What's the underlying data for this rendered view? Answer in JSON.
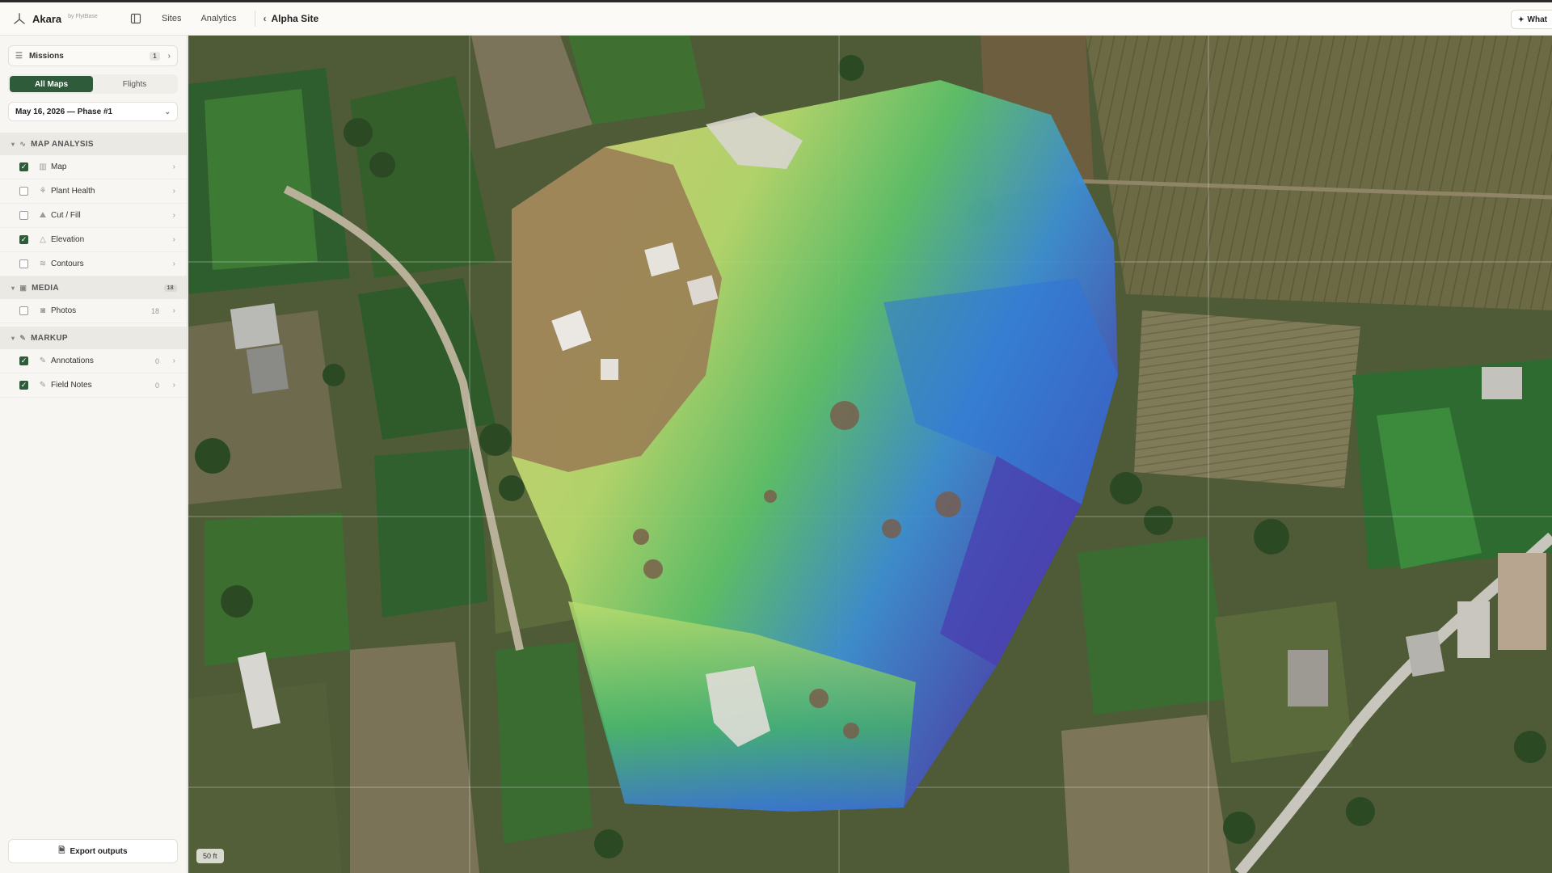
{
  "header": {
    "brand": "Akara",
    "brand_by": "by FlytBase",
    "nav": [
      "Sites",
      "Analytics"
    ],
    "breadcrumb": "Alpha Site",
    "whats_new": "What"
  },
  "sidebar": {
    "missions": {
      "label": "Missions",
      "count": "1"
    },
    "tabs": {
      "all_maps": "All Maps",
      "flights": "Flights"
    },
    "date_select": "May 16, 2026 — Phase #1",
    "sections": {
      "map_analysis": {
        "title": "MAP ANALYSIS",
        "items": [
          {
            "label": "Map",
            "checked": true,
            "icon": "map-icon"
          },
          {
            "label": "Plant Health",
            "checked": false,
            "icon": "leaf-icon"
          },
          {
            "label": "Cut / Fill",
            "checked": false,
            "icon": "cut-fill-icon"
          },
          {
            "label": "Elevation",
            "checked": true,
            "icon": "mountain-icon"
          },
          {
            "label": "Contours",
            "checked": false,
            "icon": "contour-icon"
          }
        ]
      },
      "media": {
        "title": "MEDIA",
        "badge": "18",
        "items": [
          {
            "label": "Photos",
            "checked": false,
            "count": "18",
            "icon": "camera-icon"
          }
        ]
      },
      "markup": {
        "title": "MARKUP",
        "items": [
          {
            "label": "Annotations",
            "checked": true,
            "count": "0",
            "icon": "pen-icon"
          },
          {
            "label": "Field Notes",
            "checked": true,
            "count": "0",
            "icon": "pen-icon"
          }
        ]
      }
    },
    "export": "Export outputs"
  },
  "map": {
    "scale": "50 ft"
  },
  "colors": {
    "accent": "#2e5c3a",
    "elevation_low": "#4a3fb0",
    "elevation_mid": "#5ec46a",
    "elevation_high": "#e6e070"
  }
}
